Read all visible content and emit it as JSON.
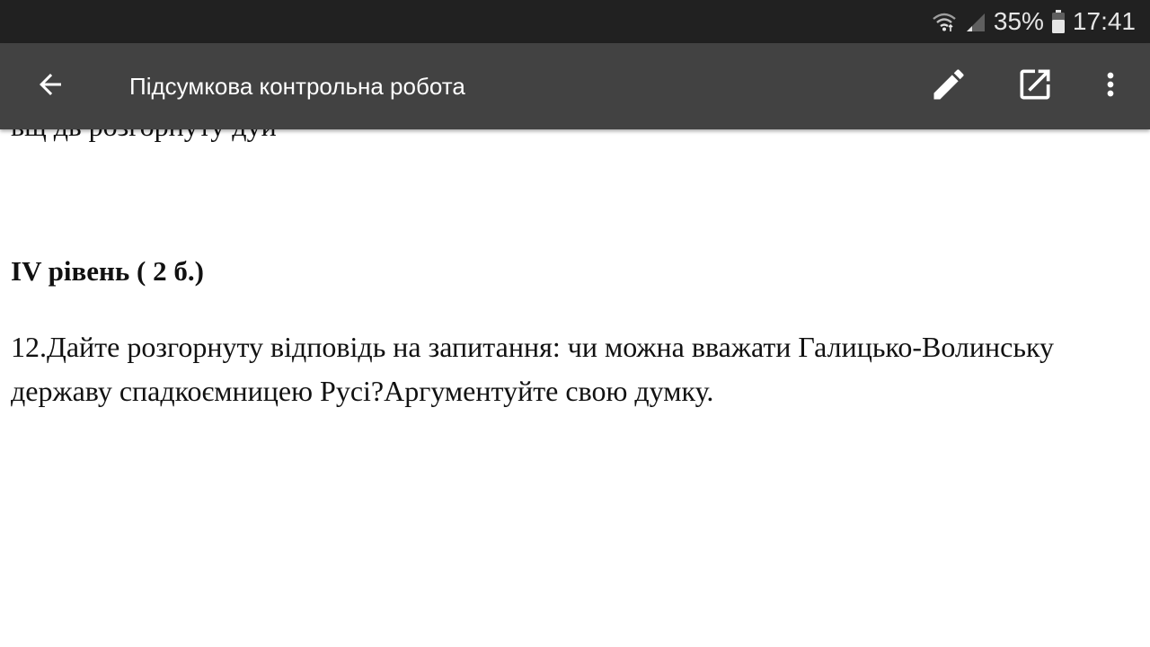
{
  "status_bar": {
    "battery_percent": "35%",
    "time": "17:41",
    "icons": [
      "wifi-icon",
      "signal-icon",
      "battery-icon"
    ]
  },
  "toolbar": {
    "title": "Підсумкова контрольна робота",
    "icons": [
      "back-arrow-icon",
      "edit-pencil-icon",
      "open-external-icon",
      "more-vert-icon"
    ]
  },
  "document": {
    "clipped_line": "вщ дь розгорнуту дуй",
    "level_heading": "IV рівень ( 2 б.)",
    "question": "12.Дайте розгорнуту відповідь на запитання: чи можна вважати Галицько-Волинську державу спадкоємницею Русі?Аргументуйте свою думку."
  },
  "colors": {
    "status_bar": "#212121",
    "toolbar": "#424242",
    "toolbar_text": "#ffffff",
    "document_bg": "#ffffff",
    "document_text": "#111111"
  }
}
